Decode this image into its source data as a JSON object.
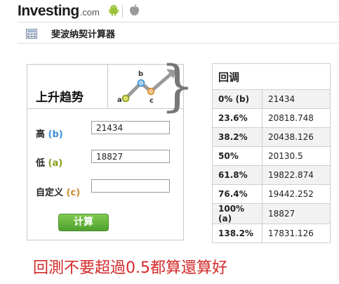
{
  "header": {
    "logo_main": "Investing",
    "logo_domain": ".com"
  },
  "page": {
    "title": "斐波纳契计算器"
  },
  "calculator": {
    "trend_title": "上升趋势",
    "graphic_labels": {
      "a": "a",
      "b": "b",
      "c": "c"
    },
    "high_label": "高",
    "high_letter": "(b)",
    "high_value": "21434",
    "low_label": "低",
    "low_letter": "(a)",
    "low_value": "18827",
    "custom_label": "自定义",
    "custom_letter": "(c)",
    "custom_value": "",
    "calculate_label": "计算"
  },
  "retracement": {
    "title": "回调",
    "rows": [
      {
        "level": "0% (b)",
        "value": "21434"
      },
      {
        "level": "23.6%",
        "value": "20818.748"
      },
      {
        "level": "38.2%",
        "value": "20438.126"
      },
      {
        "level": "50%",
        "value": "20130.5"
      },
      {
        "level": "61.8%",
        "value": "19822.874"
      },
      {
        "level": "76.4%",
        "value": "19442.252"
      },
      {
        "level": "100% (a)",
        "value": "18827"
      },
      {
        "level": "138.2%",
        "value": "17831.126"
      }
    ]
  },
  "annotation": {
    "text": "回測不要超過0.5都算還算好"
  },
  "colors": {
    "letter_b": "#3a8fd6",
    "letter_a": "#8a9a1a",
    "letter_c": "#d08a2a",
    "button_green": "#5fae3a",
    "annotation_red": "#d42a2a"
  },
  "icons": [
    "android-icon",
    "apple-icon",
    "calculator-icon"
  ]
}
